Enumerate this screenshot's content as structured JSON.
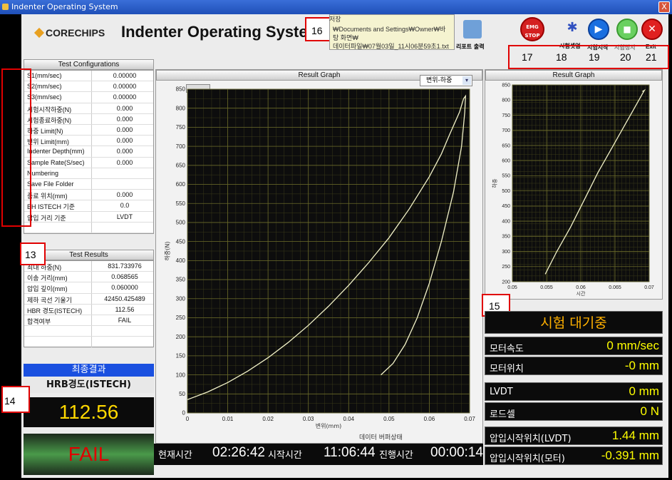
{
  "window": {
    "title": "Indenter Operating System",
    "close_glyph": "X"
  },
  "header": {
    "logo": "CORECHIPS",
    "app_title": "Indenter Operating System"
  },
  "save": {
    "label": "저장",
    "path_line1": "₩Documents and Settings₩Owner₩바탕 화면₩",
    "path_line2": "데이터파일₩07월03일_11시06분59초1.txt"
  },
  "report_button": "리포트 출력",
  "toolbar": {
    "emg_stop": "EMG STOP",
    "setup": "시험셋업",
    "start": "시험시작",
    "stop": "시험정지",
    "exit": "Exit",
    "numbers": [
      "17",
      "18",
      "19",
      "20",
      "21"
    ]
  },
  "annotations": [
    "16",
    "13",
    "15",
    "14"
  ],
  "config": {
    "header": "Test Configurations",
    "rows": [
      {
        "k": "S1(mm/sec)",
        "v": "0.00000"
      },
      {
        "k": "S2(mm/sec)",
        "v": "0.00000"
      },
      {
        "k": "S3(mm/sec)",
        "v": "0.00000"
      },
      {
        "k": "시험시작하중(N)",
        "v": "0.000"
      },
      {
        "k": "시험종료하중(N)",
        "v": "0.000"
      },
      {
        "k": "하중 Limit(N)",
        "v": "0.000"
      },
      {
        "k": "변위 Limit(mm)",
        "v": "0.000"
      },
      {
        "k": "Indenter Depth(mm)",
        "v": "0.000"
      },
      {
        "k": "Sample Rate(S/sec)",
        "v": "0.000"
      },
      {
        "k": "Numbering",
        "v": ""
      },
      {
        "k": "Save File Folder",
        "v": ""
      },
      {
        "k": "종료 위치(mm)",
        "v": "0.000"
      },
      {
        "k": "BH ISTECH 기준",
        "v": "0.0"
      },
      {
        "k": "압입 거리 기준",
        "v": "LVDT"
      },
      {
        "k": "",
        "v": ""
      }
    ]
  },
  "results": {
    "header": "Test Results",
    "rows": [
      {
        "k": "최대 하중(N)",
        "v": "831.733976"
      },
      {
        "k": "이송 거리(mm)",
        "v": "0.068565"
      },
      {
        "k": "압입 깊이(mm)",
        "v": "0.060000"
      },
      {
        "k": "제하 곡선 기울기",
        "v": "42450.425489"
      },
      {
        "k": "HBR 경도(ISTECH)",
        "v": "112.56"
      },
      {
        "k": "합격여부",
        "v": "FAIL"
      },
      {
        "k": "",
        "v": ""
      },
      {
        "k": "",
        "v": ""
      }
    ]
  },
  "final": {
    "title": "최종결과",
    "subtitle": "HRB경도(ISTECH)",
    "value": "112.56",
    "verdict": "FAIL"
  },
  "main_graph": {
    "header": "Result Graph",
    "mode": "변위-하중",
    "footer": "데이터 버퍼상태"
  },
  "side_graph": {
    "header": "Result Graph"
  },
  "status": {
    "state": "시험 대기중",
    "rows": [
      {
        "k": "모터속도",
        "v": "0 mm/sec"
      },
      {
        "k": "모터위치",
        "v": "-0 mm"
      },
      {
        "k": "LVDT",
        "v": "0 mm"
      },
      {
        "k": "로드셀",
        "v": "0 N"
      },
      {
        "k": "압입시작위치(LVDT)",
        "v": "1.44 mm"
      },
      {
        "k": "압입시작위치(모터)",
        "v": "-0.391 mm"
      }
    ]
  },
  "times": {
    "now_label": "현재시간",
    "now": "02:26:42",
    "start_label": "시작시간",
    "start": "11:06:44",
    "elapsed_label": "진행시간",
    "elapsed": "00:00:14"
  },
  "chart_data": [
    {
      "type": "line",
      "xlabel": "변위(mm)",
      "ylabel": "하중(N)",
      "xlim": [
        0,
        0.07
      ],
      "ylim": [
        0,
        850
      ],
      "xticks": [
        "0",
        "0.01",
        "0.02",
        "0.03",
        "0.04",
        "0.05",
        "0.06",
        "0.07"
      ],
      "yticks": [
        "0",
        "50",
        "100",
        "150",
        "200",
        "250",
        "300",
        "350",
        "400",
        "450",
        "500",
        "550",
        "600",
        "650",
        "700",
        "750",
        "800",
        "850"
      ],
      "grid": true,
      "series": [
        {
          "x": [
            0.0,
            0.005,
            0.01,
            0.015,
            0.02,
            0.025,
            0.03,
            0.035,
            0.04,
            0.045,
            0.05,
            0.055,
            0.06,
            0.063,
            0.065,
            0.0675,
            0.0685,
            0.069,
            0.0688,
            0.068,
            0.066,
            0.063,
            0.06,
            0.057,
            0.054,
            0.051,
            0.048
          ],
          "y": [
            35,
            55,
            80,
            110,
            145,
            185,
            230,
            280,
            335,
            395,
            460,
            535,
            620,
            680,
            730,
            790,
            825,
            832,
            790,
            700,
            580,
            450,
            340,
            250,
            180,
            130,
            100
          ]
        }
      ]
    },
    {
      "type": "line",
      "xlabel": "시간",
      "ylabel": "하중",
      "xlim": [
        0.05,
        0.07
      ],
      "ylim": [
        200,
        850
      ],
      "xticks": [
        "0.05",
        "0.055",
        "0.06",
        "0.065",
        "0.07"
      ],
      "yticks": [
        "200",
        "250",
        "300",
        "350",
        "400",
        "450",
        "500",
        "550",
        "600",
        "650",
        "700",
        "750",
        "800",
        "850"
      ],
      "grid": true,
      "series": [
        {
          "x": [
            0.0548,
            0.0565,
            0.0585,
            0.0605,
            0.0625,
            0.0645,
            0.0665,
            0.068,
            0.069,
            0.0693,
            0.069
          ],
          "y": [
            225,
            300,
            380,
            470,
            560,
            640,
            720,
            780,
            820,
            832,
            828
          ]
        }
      ]
    }
  ]
}
